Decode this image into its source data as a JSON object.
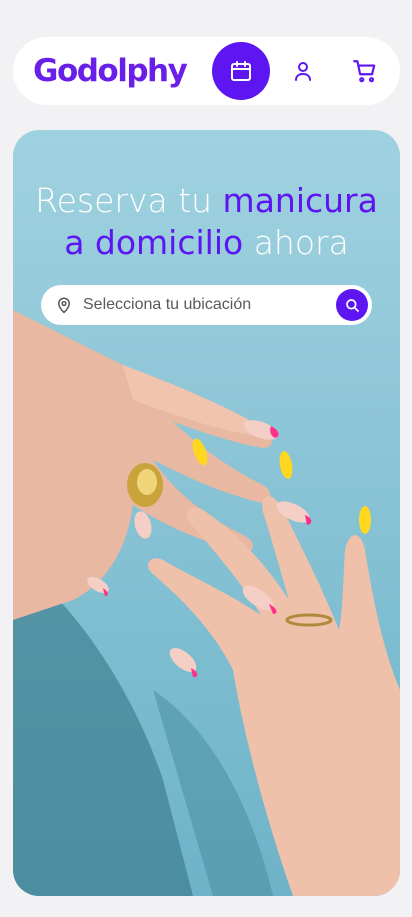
{
  "header": {
    "logo_text": "Godolphy",
    "icons": [
      "calendar-icon",
      "user-icon",
      "cart-icon"
    ]
  },
  "hero": {
    "headline": {
      "part1": "Reserva tu ",
      "part2": "manicura",
      "part3": "a domicilio",
      "part4": " ahora"
    },
    "search": {
      "placeholder": "Selecciona tu ubicación"
    }
  },
  "colors": {
    "brand_purple": "#5d16f2",
    "background": "#f2f2f4",
    "hero_sky": "#8fc7d8"
  }
}
